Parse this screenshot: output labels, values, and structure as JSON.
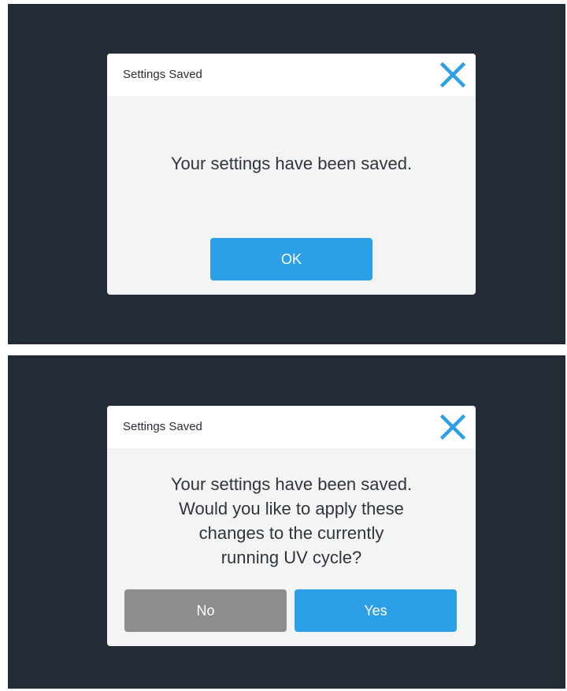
{
  "dialog_1": {
    "title": "Settings Saved",
    "close_icon": "close-x-icon",
    "message": "Your settings have been saved.",
    "ok_label": "OK"
  },
  "dialog_2": {
    "title": "Settings Saved",
    "close_icon": "close-x-icon",
    "message_lines": [
      "Your settings have been saved.",
      "Would you like to apply these",
      "changes to the currently",
      "running UV cycle?"
    ],
    "no_label": "No",
    "yes_label": "Yes"
  },
  "colors": {
    "background": "#232b36",
    "dialog_body": "#f3f5f4",
    "accent_blue": "#2d9fe6",
    "button_grey": "#8d8d8d"
  }
}
